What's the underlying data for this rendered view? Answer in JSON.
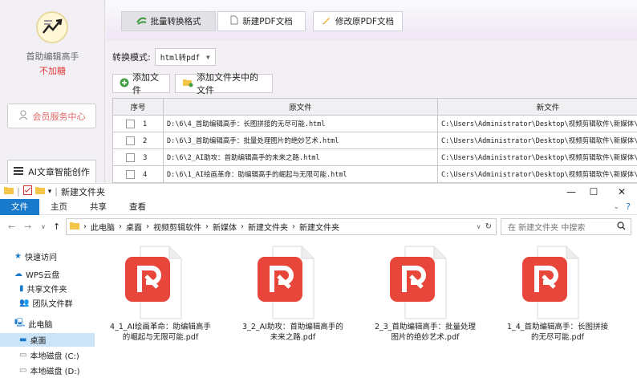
{
  "app": {
    "name": "首助编辑高手",
    "status": "不加糖",
    "vip_label": "会员服务中心",
    "ai_label": "AI文章智能创作"
  },
  "toolbar": {
    "batch_convert": "批量转换格式",
    "new_pdf": "新建PDF文档",
    "edit_pdf": "修改原PDF文档"
  },
  "mode": {
    "label": "转换模式:",
    "value": "html转pdf"
  },
  "actions": {
    "add_file": "添加文件",
    "add_folder": "添加文件夹中的文件"
  },
  "table": {
    "headers": [
      "序号",
      "原文件",
      "新文件"
    ],
    "rows": [
      {
        "n": "1",
        "src": "D:\\6\\4_首助编辑高手：长图拼接的无尽可能.html",
        "dst": "C:\\Users\\Administrator\\Desktop\\视频剪辑软件\\新媒体\\新"
      },
      {
        "n": "2",
        "src": "D:\\6\\3_首助编辑高手：批量处理图片的绝妙艺术.html",
        "dst": "C:\\Users\\Administrator\\Desktop\\视频剪辑软件\\新媒体\\新"
      },
      {
        "n": "3",
        "src": "D:\\6\\2_AI助攻：首助编辑高手的未来之路.html",
        "dst": "C:\\Users\\Administrator\\Desktop\\视频剪辑软件\\新媒体\\新"
      },
      {
        "n": "4",
        "src": "D:\\6\\1_AI绘画革命：助编辑高手的崛起与无限可能.html",
        "dst": "C:\\Users\\Administrator\\Desktop\\视频剪辑软件\\新媒体\\新"
      }
    ]
  },
  "explorer": {
    "title": "新建文件夹",
    "ribbon": [
      "文件",
      "主页",
      "共享",
      "查看"
    ],
    "path": [
      "此电脑",
      "桌面",
      "视频剪辑软件",
      "新媒体",
      "新建文件夹",
      "新建文件夹"
    ],
    "search_placeholder": "在 新建文件夹 中搜索",
    "nav": [
      "快速访问",
      "WPS云盘",
      "共享文件夹",
      "团队文件群",
      "此电脑",
      "桌面",
      "本地磁盘 (C:)",
      "本地磁盘 (D:)"
    ],
    "files": [
      {
        "l1": "4_1_AI绘画革命：助编辑高手",
        "l2": "的崛起与无限可能.pdf"
      },
      {
        "l1": "3_2_AI助攻：首助编辑高手的",
        "l2": "未来之路.pdf"
      },
      {
        "l1": "2_3_首助编辑高手：批量处理",
        "l2": "图片的绝妙艺术.pdf"
      },
      {
        "l1": "1_4_首助编辑高手：长图拼接",
        "l2": "的无尽可能.pdf"
      }
    ]
  },
  "colors": {
    "file_tab": "#1979ca",
    "pdf_red": "#e8463a",
    "vip": "#e06666"
  }
}
